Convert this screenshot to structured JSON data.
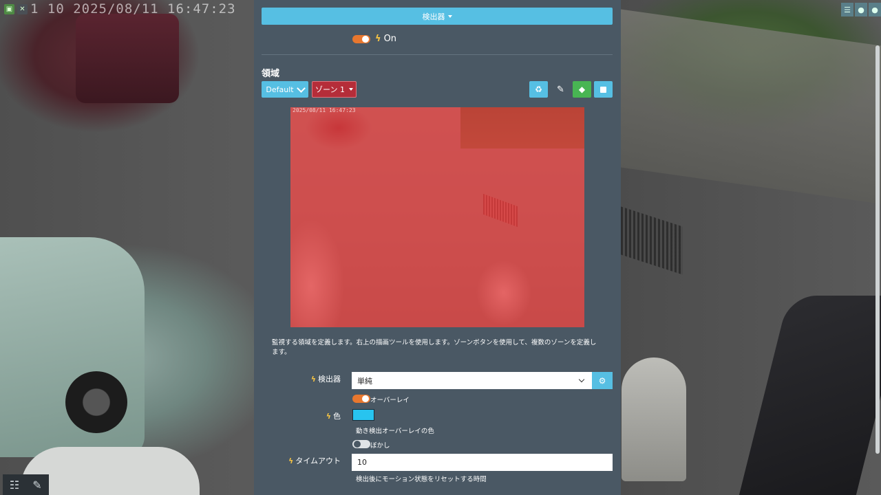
{
  "camera": {
    "timestamp": "1 10 2025/08/11 16:47:23",
    "preview_timestamp": "2025/08/11 16:47:23"
  },
  "panel": {
    "detector_header": "検出器",
    "power_toggle": {
      "label": "On",
      "state": "on"
    },
    "region": {
      "title": "領域",
      "preset_label": "Default",
      "zone_label": "ゾーン 1",
      "tools": [
        "recycle-icon",
        "brush-icon",
        "eraser-icon",
        "square-icon"
      ]
    },
    "overlay_color": "#ec3c3c",
    "description": "監視する領域を定義します。右上の描画ツールを使用します。ゾーンボタンを使用して、複数のゾーンを定義します。",
    "fields": {
      "detector": {
        "label": "検出器",
        "value": "単純"
      },
      "overlay": {
        "label": "オーバーレイ",
        "state": "on"
      },
      "color": {
        "label": "色",
        "value": "#28c4ef",
        "hint": "動き検出オーバーレイの色"
      },
      "blur": {
        "label": "ぼかし",
        "state": "off"
      },
      "timeout": {
        "label": "タイムアウト",
        "value": "10",
        "hint": "検出後にモーション状態をリセットする時間"
      }
    }
  }
}
